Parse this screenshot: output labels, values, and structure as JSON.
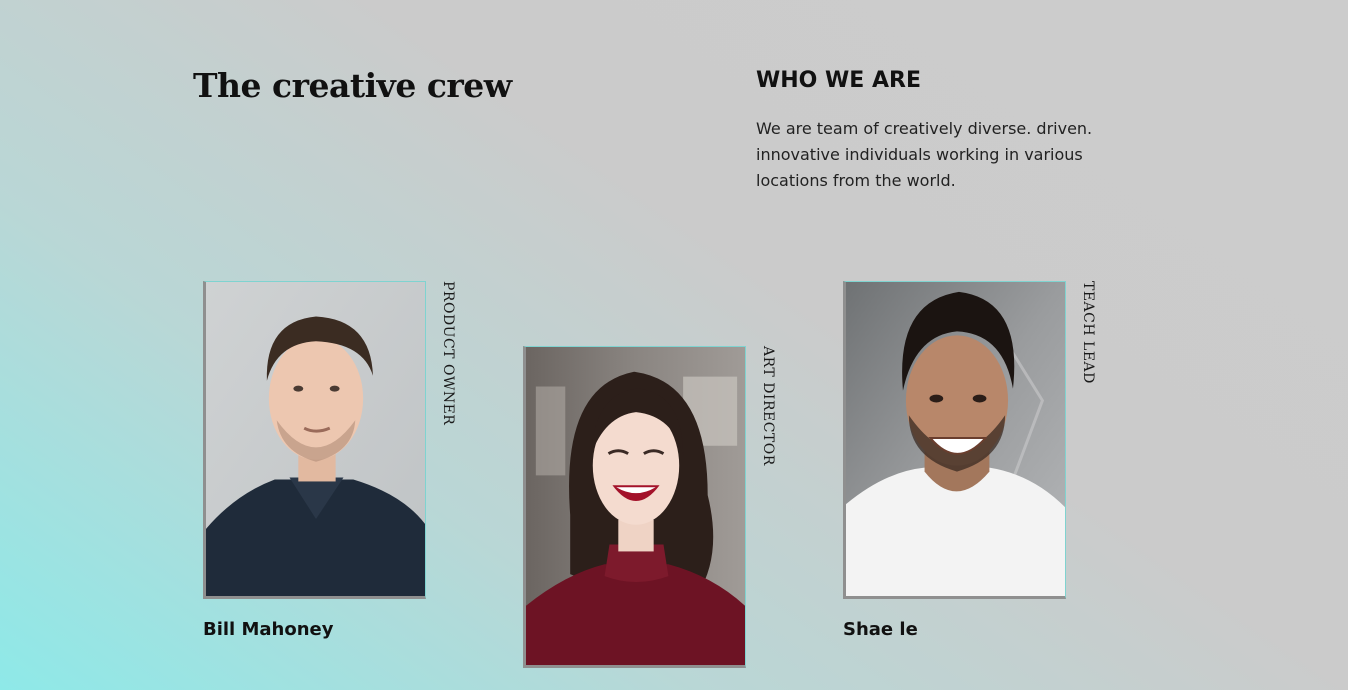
{
  "header": {
    "title": "The creative crew"
  },
  "about": {
    "heading": "WHO WE ARE",
    "text": "We are team of creatively diverse. driven. innovative individuals working in various locations from the world."
  },
  "team": [
    {
      "name": "Bill Mahoney",
      "role": "PRODUCT OWNER"
    },
    {
      "name": "",
      "role": "ART DIRECTOR"
    },
    {
      "name": "Shae le",
      "role": "TEACH LEAD"
    }
  ]
}
